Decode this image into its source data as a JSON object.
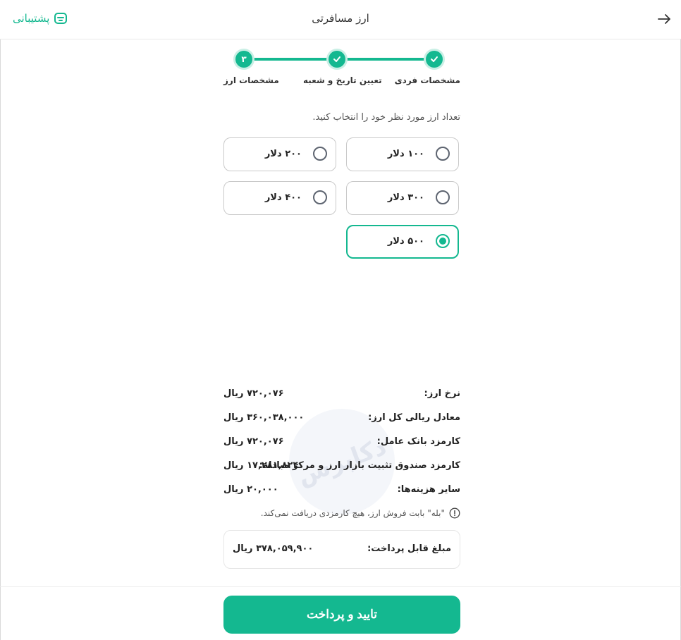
{
  "header": {
    "title": "ارز مسافرتی",
    "support_label": "پشتیبانی",
    "back_icon": "arrow-right-icon",
    "support_icon": "support-icon"
  },
  "steps": [
    {
      "label": "مشخصات فردی",
      "state": "done"
    },
    {
      "label": "تعیین تاریخ و شعبه",
      "state": "done"
    },
    {
      "label": "مشخصات ارز",
      "state": "current",
      "number": "۳"
    }
  ],
  "prompt": "تعداد ارز مورد نظر خود را انتخاب کنید.",
  "options": [
    {
      "label": "۱۰۰ دلار",
      "selected": false
    },
    {
      "label": "۲۰۰ دلار",
      "selected": false
    },
    {
      "label": "۳۰۰ دلار",
      "selected": false
    },
    {
      "label": "۴۰۰ دلار",
      "selected": false
    },
    {
      "label": "۵۰۰ دلار",
      "selected": true
    }
  ],
  "summary": [
    {
      "label": "نرخ ارز:",
      "value": "۷۲۰,۰۷۶ ریال"
    },
    {
      "label": "معادل ریالی کل ارز:",
      "value": "۳۶۰,۰۳۸,۰۰۰ ریال"
    },
    {
      "label": "کارمزد بانک عامل:",
      "value": "۷۲۰,۰۷۶ ریال"
    },
    {
      "label": "کارمزد صندوق تثبیت بازار ارز و مرکز مبادله:",
      "value": "۱۷,۲۸۱,۸۲۴ ریال"
    },
    {
      "label": "سایر هزینه‌ها:",
      "value": "۲۰,۰۰۰ ریال"
    }
  ],
  "note": "\"بله\" بابت فروش ارز، هیچ کارمزدی دریافت نمی‌کند.",
  "total": {
    "label": "مبلغ قابل پرداخت:",
    "value": "۳۷۸,۰۵۹,۹۰۰ ریال"
  },
  "pay_button": "تایید و پرداخت",
  "watermark": "دکاپرس",
  "colors": {
    "accent": "#14b890",
    "accent_light": "#c9efe5",
    "border": "#c9c9c9"
  }
}
